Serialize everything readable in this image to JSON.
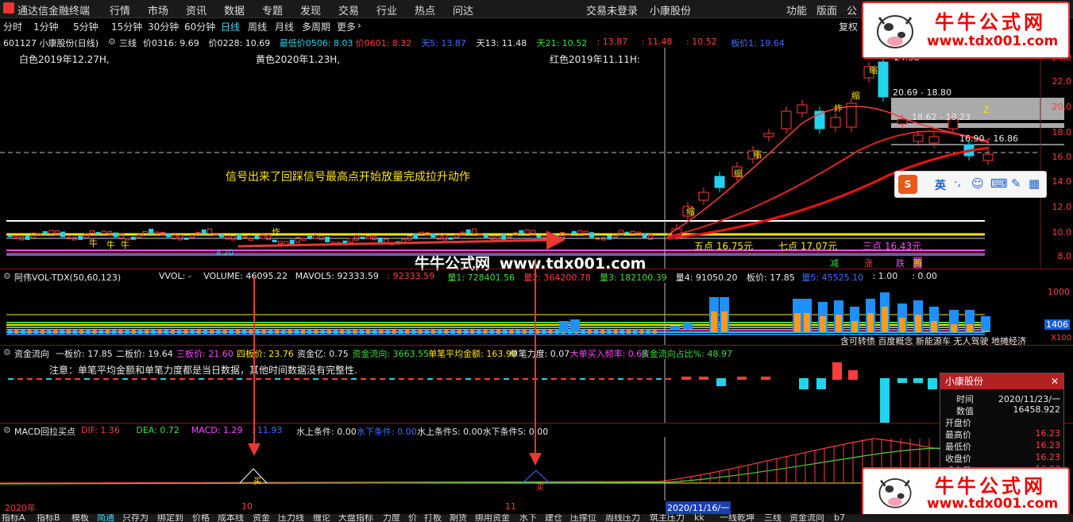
{
  "menubar": {
    "app_title": "通达信金融终端",
    "items": [
      "行情",
      "市场",
      "资讯",
      "数据",
      "专题",
      "发现",
      "交易",
      "行业",
      "热点",
      "问达"
    ],
    "trade_status": "交易未登录",
    "stock": "小康股份",
    "right_items": [
      "功能",
      "版面",
      "公"
    ]
  },
  "periods": [
    "分时",
    "1分钟",
    "5分钟",
    "15分钟",
    "30分钟",
    "60分钟",
    "日线",
    "周线",
    "月线",
    "多周期",
    "更多"
  ],
  "active_period": "日线",
  "toolbar_right": "复权",
  "kline_header": {
    "code_name": "601127 小康股份(日线)",
    "indicator": "三线",
    "items": [
      {
        "text": "价0316: 9.69",
        "color": "#eaeaea"
      },
      {
        "text": "价0228: 10.69",
        "color": "#eaeaea"
      },
      {
        "text": "最低价0506: 8.03",
        "color": "#22d3ee"
      },
      {
        "text": "价0601: 8.32",
        "color": "#ff3b3b"
      },
      {
        "text": "天5: 13.87",
        "color": "#3b6dff"
      },
      {
        "text": "天13: 11.48",
        "color": "#eaeaea"
      },
      {
        "text": "天21: 10.52",
        "color": "#3ddc3d"
      },
      {
        "text": ": 13.87",
        "color": "#ff3b3b"
      },
      {
        "text": ": 11.48",
        "color": "#ff3b3b"
      },
      {
        "text": ": 10.52",
        "color": "#ff3b3b"
      },
      {
        "text": "板价1: 19.64",
        "color": "#3b6dff"
      }
    ]
  },
  "kline_annotations": {
    "white_label": "白色2019年12.27H,",
    "yellow_label": "黄色2020年1.23H,",
    "red_label": "红色2019年11.11H:",
    "signal_text": "信号出来了回踩信号最高点开始放量完成拉升动作",
    "five_point": "五点 16.75元",
    "seven_point": "七点 17.07元",
    "three_point": "三点 16.43元",
    "price_2469": "24.38",
    "range1": "20.69 - 18.80",
    "range2": "18.62 - 18.23",
    "range3": "16.90 - 16.86",
    "z_label": "Z",
    "low_label": "8.20",
    "suo": "缩",
    "zha": "炸",
    "niu": "牛",
    "jian": "减",
    "zhang": "涨",
    "die": "跌",
    "teng": "腾"
  },
  "price_axis": [
    "24.0",
    "22.0",
    "20.0",
    "18.0",
    "16.0",
    "14.0",
    "12.0",
    "10.0",
    "8.0"
  ],
  "watermark": {
    "name": "牛牛公式网",
    "url": "www.tdx001.com"
  },
  "ime": {
    "lang": "英",
    "punct": "·,"
  },
  "vol_header": {
    "name": "阿伟VOL-TDX(50,60,123)",
    "items": [
      {
        "text": "VVOL: -",
        "color": "#eaeaea"
      },
      {
        "text": "VOLUME: 46095.22",
        "color": "#eaeaea"
      },
      {
        "text": "MAVOL5: 92333.59",
        "color": "#eaeaea"
      },
      {
        "text": ": 92333.59",
        "color": "#ff3b3b"
      },
      {
        "text": "量1: 728401.56",
        "color": "#3ddc3d"
      },
      {
        "text": "量2: 364200.78",
        "color": "#ff3b3b"
      },
      {
        "text": "量3: 182100.39",
        "color": "#3ddc3d"
      },
      {
        "text": "量4: 91050.20",
        "color": "#eaeaea"
      },
      {
        "text": "板价: 17.85",
        "color": "#eaeaea"
      },
      {
        "text": "量5: 45525.10",
        "color": "#3b6dff"
      },
      {
        "text": ": 1.00",
        "color": "#eaeaea"
      },
      {
        "text": ": 0.00",
        "color": "#eaeaea"
      }
    ],
    "axis_top": "1000",
    "axis_val": "1406",
    "axis_unit": "X100"
  },
  "concepts": "含可转债 百度概念 新能源车 无人驾驶 地摊经济",
  "flow_header": {
    "name": "资金流向",
    "items": [
      {
        "text": "一板价: 17.85",
        "color": "#eaeaea"
      },
      {
        "text": "二板价: 19.64",
        "color": "#eaeaea"
      },
      {
        "text": "三板价: 21.60",
        "color": "#ff44ff"
      },
      {
        "text": "四板价: 23.76",
        "color": "#ffe600"
      },
      {
        "text": "资金亿: 0.75",
        "color": "#eaeaea"
      },
      {
        "text": "资金流向: 3663.55",
        "color": "#3ddc3d"
      },
      {
        "text": "单笔平均金额: 163.90",
        "color": "#ffe600"
      },
      {
        "text": "单笔力度: 0.07",
        "color": "#eaeaea"
      },
      {
        "text": "大单买入频率: 0.68",
        "color": "#ff44ff"
      },
      {
        "text": "资金流向占比%: 48.97",
        "color": "#3ddc3d"
      }
    ],
    "note": "注意：单笔平均金额和单笔力度都是当日数据，其他时间数据没有完整性."
  },
  "macd_header": {
    "name": "MACD回拉买点",
    "items": [
      {
        "text": "DIF: 1.36",
        "color": "#ff3b3b"
      },
      {
        "text": "DEA: 0.72",
        "color": "#3ddc3d"
      },
      {
        "text": "MACD: 1.29",
        "color": "#ff44ff"
      },
      {
        "text": ": 11.93",
        "color": "#3b6dff"
      },
      {
        "text": "水上条件: 0.00",
        "color": "#eaeaea"
      },
      {
        "text": "水下条件: 0.00",
        "color": "#3b6dff"
      },
      {
        "text": "水上条件S: 0.00",
        "color": "#eaeaea"
      },
      {
        "text": "水下条件S: 0.00",
        "color": "#eaeaea"
      }
    ],
    "buy_marker": "买"
  },
  "date_axis": {
    "year": "2020年",
    "m10": "10",
    "m11": "11",
    "cursor": "2020/11/16/一"
  },
  "info_panel": {
    "title": "小康股份",
    "rows": [
      {
        "k": "时间",
        "v": "2020/11/23/一"
      },
      {
        "k": "数值",
        "v": "16458.922"
      },
      {
        "k": "开盘价",
        "v": ""
      },
      {
        "k": "最高价",
        "v": "16.23"
      },
      {
        "k": "最低价",
        "v": "16.23"
      },
      {
        "k": "收盘价",
        "v": "16.23"
      },
      {
        "k": "成交量",
        "v": "16.23"
      }
    ]
  },
  "bottom_tabs": [
    "指标A",
    "指标B",
    "模板",
    "简通",
    "只存为",
    "绑定到",
    "价格",
    "成本线",
    "资金",
    "压力线",
    "缠论",
    "大盘指标",
    "力度",
    "价",
    "打板",
    "期货",
    "绑用资金",
    "水下",
    "建仓",
    "压撑位",
    "周线压力",
    "筑主压力",
    "kk",
    "一线乾坤",
    "三线",
    "资金流向",
    "b7"
  ]
}
